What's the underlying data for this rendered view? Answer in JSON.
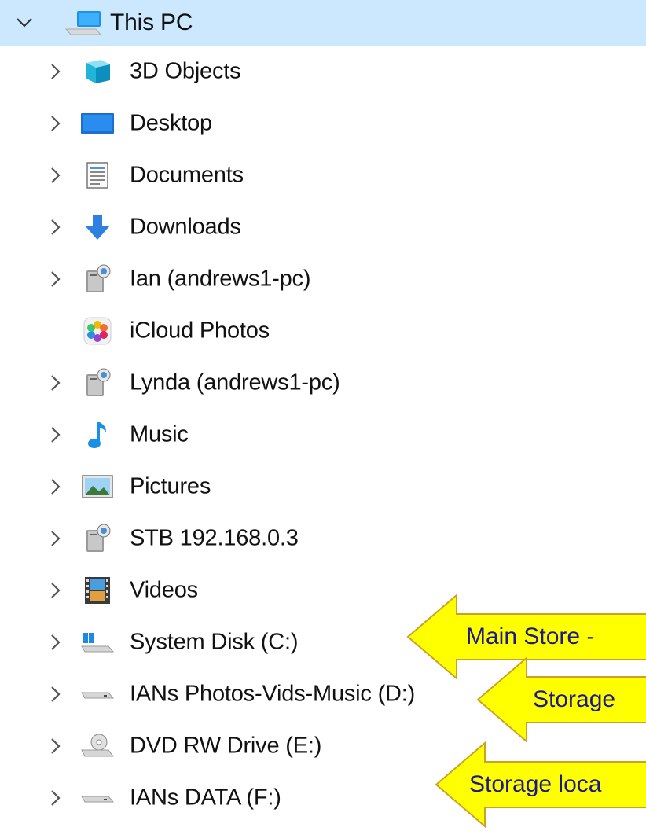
{
  "tree": {
    "root": {
      "label": "This PC",
      "icon": "computer-icon",
      "expanded": true
    },
    "items": [
      {
        "label": "3D Objects",
        "icon": "3d-objects-icon",
        "expandable": true
      },
      {
        "label": "Desktop",
        "icon": "desktop-icon",
        "expandable": true
      },
      {
        "label": "Documents",
        "icon": "documents-icon",
        "expandable": true
      },
      {
        "label": "Downloads",
        "icon": "downloads-icon",
        "expandable": true
      },
      {
        "label": "Ian (andrews1-pc)",
        "icon": "network-drive-icon",
        "expandable": true
      },
      {
        "label": "iCloud Photos",
        "icon": "icloud-photos-icon",
        "expandable": false
      },
      {
        "label": "Lynda (andrews1-pc)",
        "icon": "network-drive-icon",
        "expandable": true
      },
      {
        "label": "Music",
        "icon": "music-icon",
        "expandable": true
      },
      {
        "label": "Pictures",
        "icon": "pictures-icon",
        "expandable": true
      },
      {
        "label": "STB 192.168.0.3",
        "icon": "network-drive-icon",
        "expandable": true
      },
      {
        "label": "Videos",
        "icon": "videos-icon",
        "expandable": true
      },
      {
        "label": "System Disk (C:)",
        "icon": "windows-disk-icon",
        "expandable": true
      },
      {
        "label": "IANs Photos-Vids-Music (D:)",
        "icon": "hard-drive-icon",
        "expandable": true
      },
      {
        "label": "DVD RW Drive (E:)",
        "icon": "dvd-drive-icon",
        "expandable": true
      },
      {
        "label": "IANs DATA (F:)",
        "icon": "hard-drive-icon",
        "expandable": true
      }
    ]
  },
  "callouts": [
    {
      "text": "Main Store -"
    },
    {
      "text": "Storage"
    },
    {
      "text": "Storage loca"
    }
  ],
  "colors": {
    "selection": "#cce8ff",
    "callout_fill": "#ffff00",
    "callout_stroke": "#c9a227",
    "callout_text": "#1a1a8c"
  }
}
